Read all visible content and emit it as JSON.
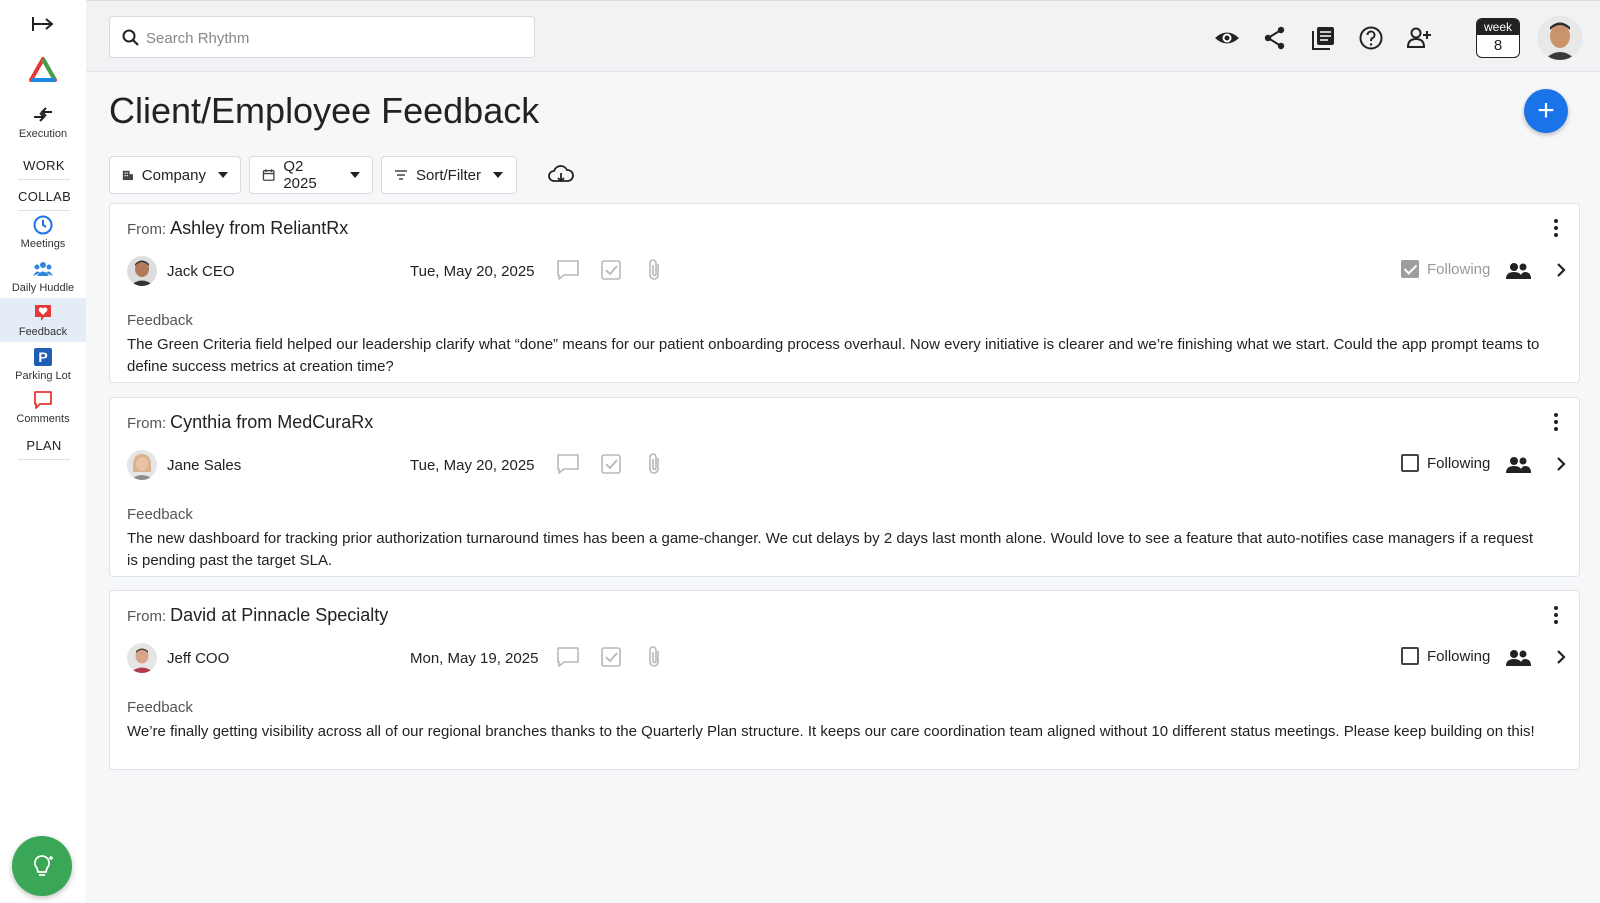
{
  "sidebar": {
    "items": [
      {
        "label": "Execution",
        "icon": "execution-arrows-icon"
      },
      {
        "label": "Meetings",
        "icon": "clock-icon"
      },
      {
        "label": "Daily Huddle",
        "icon": "people-group-icon"
      },
      {
        "label": "Feedback",
        "icon": "heart-chat-icon"
      },
      {
        "label": "Parking Lot",
        "icon": "parking-icon"
      },
      {
        "label": "Comments",
        "icon": "comment-icon"
      }
    ],
    "sections": {
      "work": "WORK",
      "collab": "COLLAB",
      "plan": "PLAN"
    }
  },
  "search": {
    "placeholder": "Search Rhythm"
  },
  "topbar": {
    "week_label": "week",
    "week_number": "8"
  },
  "page": {
    "title": "Client/Employee Feedback"
  },
  "filters": {
    "company": "Company",
    "quarter": "Q2 2025",
    "sort": "Sort/Filter"
  },
  "cards": [
    {
      "from_prefix": "From:",
      "from_name": "Ashley from ReliantRx",
      "person": "Jack CEO",
      "date": "Tue, May 20, 2025",
      "following_label": "Following",
      "following": true,
      "feedback_label": "Feedback",
      "feedback": "The Green Criteria field helped our leadership clarify what “done” means for our patient onboarding process overhaul. Now every initiative is clearer and we’re finishing what we start. Could the app prompt teams to define success metrics at creation time?"
    },
    {
      "from_prefix": "From:",
      "from_name": "Cynthia from MedCuraRx",
      "person": "Jane Sales",
      "date": "Tue, May 20, 2025",
      "following_label": "Following",
      "following": false,
      "feedback_label": "Feedback",
      "feedback": "The new dashboard for tracking prior authorization turnaround times has been a game-changer. We cut delays by 2 days last month alone. Would love to see a feature that auto-notifies case managers if a request is pending past the target SLA."
    },
    {
      "from_prefix": "From:",
      "from_name": "David at Pinnacle Specialty",
      "person": "Jeff COO",
      "date": "Mon, May 19, 2025",
      "following_label": "Following",
      "following": false,
      "feedback_label": "Feedback",
      "feedback": "We’re finally getting visibility across all of our regional branches thanks to the Quarterly Plan structure. It keeps our care coordination team aligned without 10 different status meetings. Please keep building on this!"
    }
  ],
  "colors": {
    "accent": "#1a73e8",
    "active_bg": "#e3ecf7",
    "bulb": "#3aa757"
  }
}
